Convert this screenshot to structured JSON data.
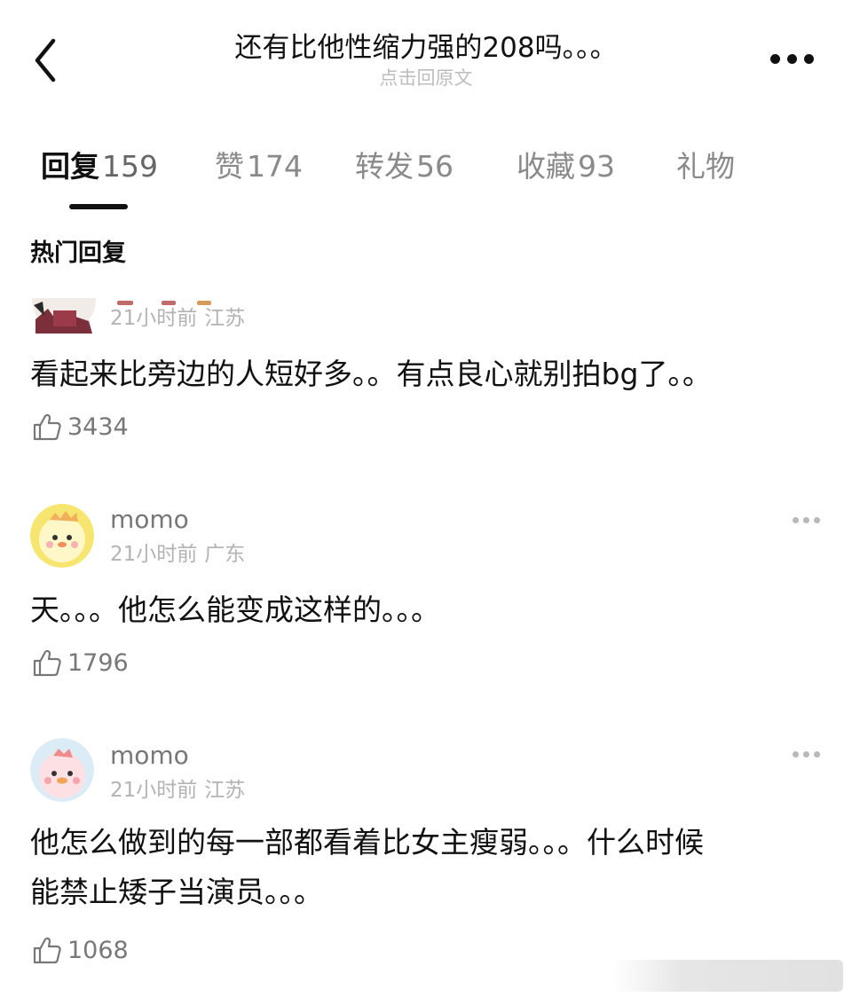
{
  "header": {
    "title": "还有比他性缩力强的208吗。。。",
    "subtitle": "点击回原文"
  },
  "tabs": [
    {
      "label": "回复",
      "count": "159",
      "active": true
    },
    {
      "label": "赞",
      "count": "174",
      "active": false
    },
    {
      "label": "转发",
      "count": "56",
      "active": false
    },
    {
      "label": "收藏",
      "count": "93",
      "active": false
    },
    {
      "label": "礼物",
      "count": "",
      "active": false
    }
  ],
  "section_title": "热门回复",
  "comments": [
    {
      "time": "21小时前",
      "location": "江苏",
      "content": "看起来比旁边的人短好多。。有点良心就别拍bg了。。",
      "likes": "3434"
    },
    {
      "username": "momo",
      "time": "21小时前",
      "location": "广东",
      "content": "天。。。他怎么能变成这样的。。。",
      "likes": "1796"
    },
    {
      "username": "momo",
      "time": "21小时前",
      "location": "江苏",
      "content_lines": [
        "他怎么做到的每一部都看着比女主瘦弱。。。什么时候",
        "能禁止矮子当演员。。。"
      ],
      "likes": "1068"
    }
  ],
  "colors": {
    "text": "#111111",
    "secondary": "#777777",
    "muted": "#b3b3b3",
    "tab_inactive": "#8a8a8a",
    "avatar_yellow": "#f5e36a",
    "avatar_pink": "#f7c6cc"
  },
  "icons": [
    "back-icon",
    "more-icon",
    "thumbs-up-icon",
    "ellipsis-icon"
  ]
}
